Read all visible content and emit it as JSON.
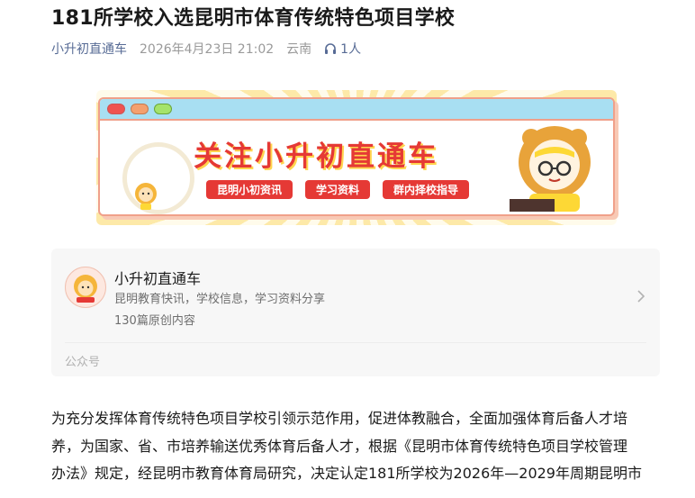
{
  "article": {
    "title": "181所学校入选昆明市体育传统特色项目学校",
    "author": "小升初直通车",
    "datetime": "2026年4月23日 21:02",
    "location": "云南",
    "listeners": "1人"
  },
  "banner": {
    "slogan": "关注小升初直通车",
    "tags": [
      "昆明小初资讯",
      "学习资料",
      "群内择校指导"
    ]
  },
  "account_card": {
    "name": "小升初直通车",
    "description": "昆明教育快讯，学校信息，学习资料分享",
    "count": "130篇原创内容",
    "type": "公众号"
  },
  "body": {
    "lines": [
      "为充分发挥体育传统特色项目学校引领示范作用，促进体教融合，全面加强体育后备人才培",
      "养，为国家、省、市培养输送优秀体育后备人才，根据《昆明市体育传统特色项目学校管理",
      "办法》规定，经昆明市教育体育局研究，决定认定181所学校为2026年—2029年周期昆明市"
    ]
  },
  "icons": [
    "headphones-icon",
    "chevron-right-icon"
  ],
  "colors": {
    "link": "#576b95",
    "accent": "#e53935"
  }
}
